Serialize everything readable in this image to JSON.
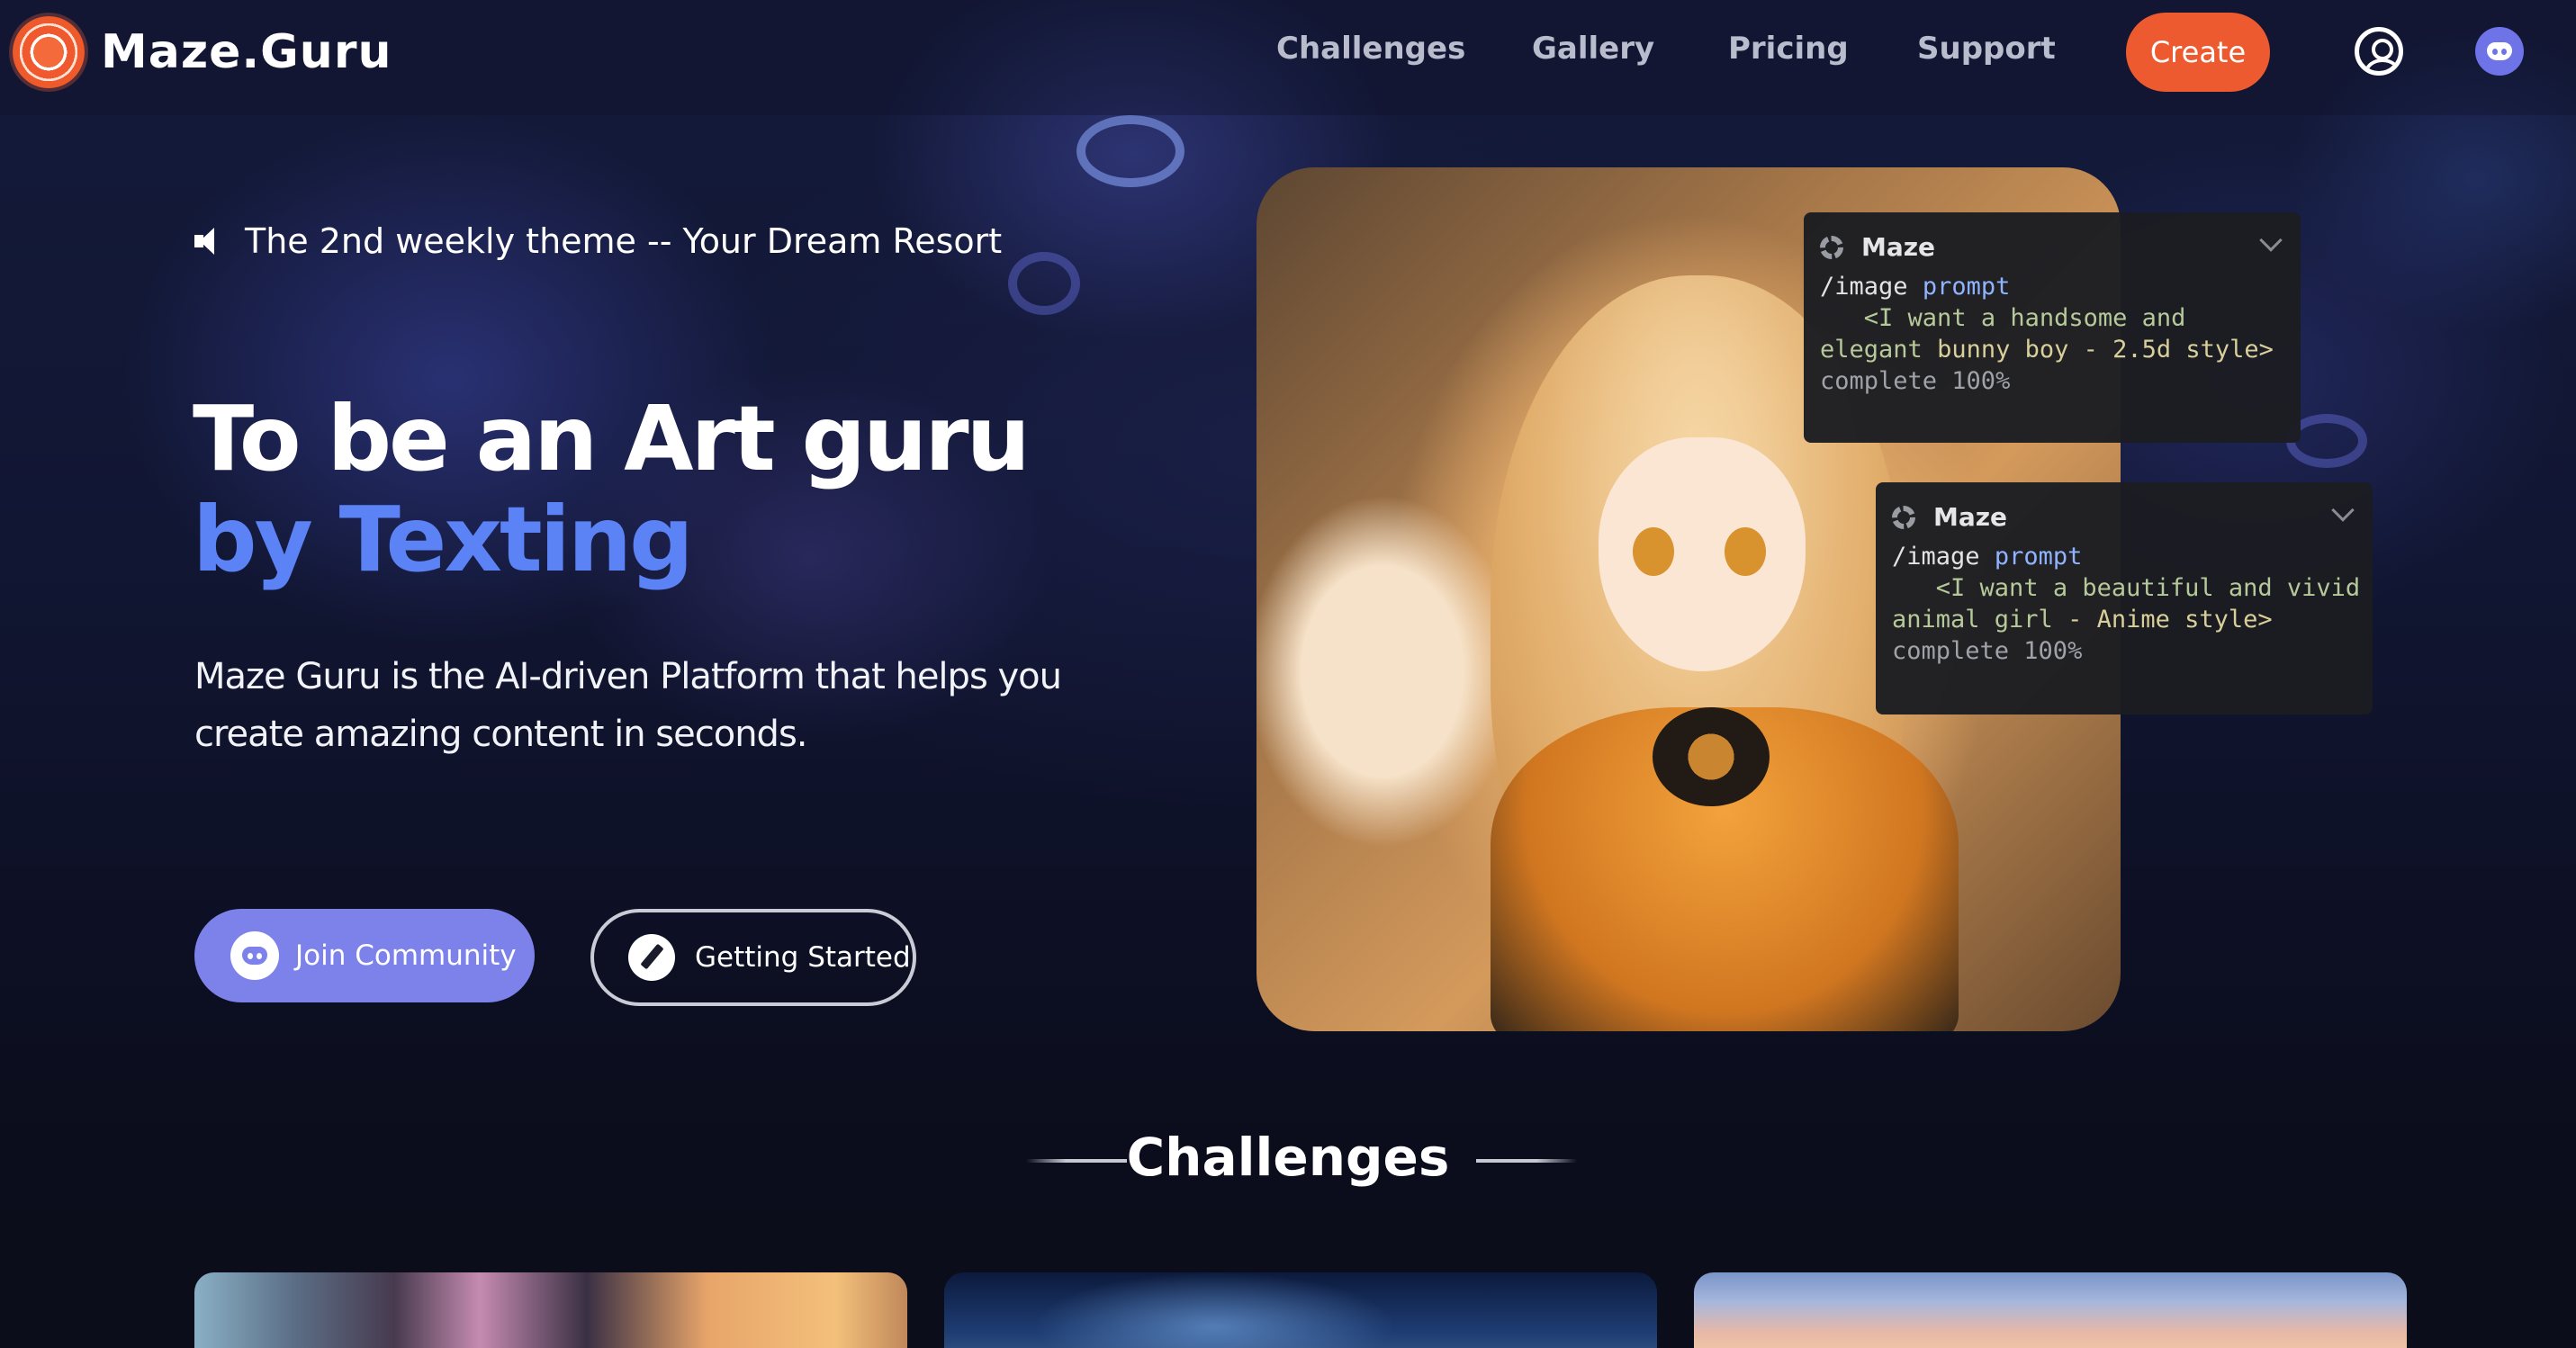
{
  "brand": {
    "name": "Maze.Guru"
  },
  "nav": {
    "links": [
      "Challenges",
      "Gallery",
      "Pricing",
      "Support"
    ],
    "create_label": "Create"
  },
  "hero": {
    "announcement": "The 2nd weekly theme -- Your Dream Resort",
    "title_line1": "To be an Art guru",
    "title_line2": "by Texting",
    "description": "Maze Guru is the AI-driven Platform that helps you create amazing content in seconds.",
    "join_label": "Join Community",
    "start_label": "Getting Started"
  },
  "chat_cards": [
    {
      "name": "Maze",
      "command": "/image",
      "arg": "prompt",
      "prompt_start": "<I want a handsome and",
      "prompt_mid": "elegant",
      "prompt_highlight": "bunny boy - 2.5d style>",
      "status": "complete 100%"
    },
    {
      "name": "Maze",
      "command": "/image",
      "arg": "prompt",
      "prompt_start": "<I want a beautiful and vivid",
      "prompt_mid": "animal girl",
      "prompt_highlight": "- Anime style>",
      "status": "complete 100%"
    }
  ],
  "sections": {
    "challenges_title": "Challenges"
  },
  "colors": {
    "accent_orange": "#ee5a2f",
    "accent_blue": "#5b83f5",
    "discord": "#7c82ea"
  }
}
